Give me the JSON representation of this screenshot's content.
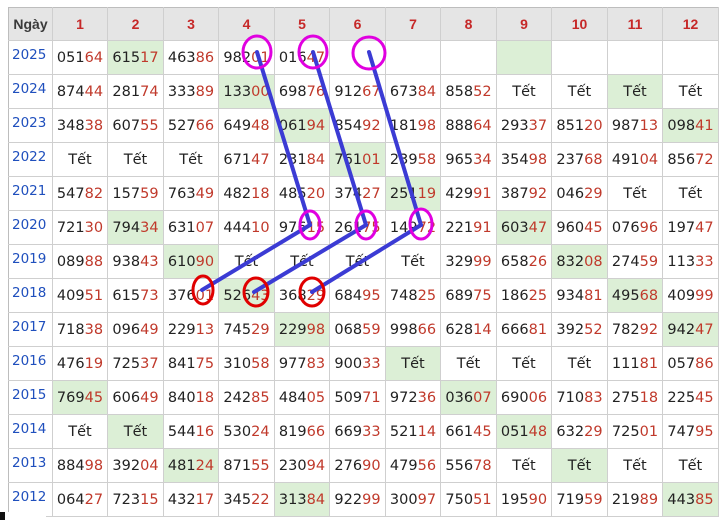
{
  "header": {
    "corner": "Ngày",
    "days": [
      "1",
      "2",
      "3",
      "4",
      "5",
      "6",
      "7",
      "8",
      "9",
      "10",
      "11",
      "12"
    ]
  },
  "rows": [
    {
      "year": "2025",
      "cells": [
        {
          "v": "05164"
        },
        {
          "v": "61517",
          "hl": true
        },
        {
          "v": "46386"
        },
        {
          "v": "98201"
        },
        {
          "v": "01647"
        },
        {
          "v": ""
        },
        {
          "v": ""
        },
        {
          "v": ""
        },
        {
          "v": "",
          "hl": true
        },
        {
          "v": ""
        },
        {
          "v": ""
        },
        {
          "v": ""
        }
      ]
    },
    {
      "year": "2024",
      "cells": [
        {
          "v": "87444"
        },
        {
          "v": "28174"
        },
        {
          "v": "33389"
        },
        {
          "v": "13300",
          "hl": true
        },
        {
          "v": "69876"
        },
        {
          "v": "91267"
        },
        {
          "v": "67384"
        },
        {
          "v": "85852"
        },
        {
          "v": "Tết"
        },
        {
          "v": "Tết"
        },
        {
          "v": "Tết",
          "hl": true
        },
        {
          "v": "Tết"
        }
      ]
    },
    {
      "year": "2023",
      "cells": [
        {
          "v": "34838"
        },
        {
          "v": "60755"
        },
        {
          "v": "52766"
        },
        {
          "v": "64948"
        },
        {
          "v": "06194",
          "hl": true
        },
        {
          "v": "85492"
        },
        {
          "v": "18198"
        },
        {
          "v": "88864"
        },
        {
          "v": "29337"
        },
        {
          "v": "85120"
        },
        {
          "v": "98713"
        },
        {
          "v": "09841",
          "hl": true
        }
      ]
    },
    {
      "year": "2022",
      "cells": [
        {
          "v": "Tết"
        },
        {
          "v": "Tết"
        },
        {
          "v": "Tết"
        },
        {
          "v": "67147"
        },
        {
          "v": "23184"
        },
        {
          "v": "76101",
          "hl": true
        },
        {
          "v": "23958"
        },
        {
          "v": "96534"
        },
        {
          "v": "35498"
        },
        {
          "v": "23768"
        },
        {
          "v": "49104"
        },
        {
          "v": "85672"
        }
      ]
    },
    {
      "year": "2021",
      "cells": [
        {
          "v": "54782"
        },
        {
          "v": "15759"
        },
        {
          "v": "76349"
        },
        {
          "v": "48218"
        },
        {
          "v": "48520"
        },
        {
          "v": "37427"
        },
        {
          "v": "25119",
          "hl": true
        },
        {
          "v": "42991"
        },
        {
          "v": "38792"
        },
        {
          "v": "04629"
        },
        {
          "v": "Tết"
        },
        {
          "v": "Tết"
        }
      ]
    },
    {
      "year": "2020",
      "cells": [
        {
          "v": "72130"
        },
        {
          "v": "79434",
          "hl": true
        },
        {
          "v": "63107"
        },
        {
          "v": "44410"
        },
        {
          "v": "97615"
        },
        {
          "v": "26175"
        },
        {
          "v": "14972"
        },
        {
          "v": "22191"
        },
        {
          "v": "60347",
          "hl": true
        },
        {
          "v": "96045"
        },
        {
          "v": "07696"
        },
        {
          "v": "19747"
        }
      ]
    },
    {
      "year": "2019",
      "cells": [
        {
          "v": "08988"
        },
        {
          "v": "93843"
        },
        {
          "v": "61090",
          "hl": true
        },
        {
          "v": "Tết"
        },
        {
          "v": "Tết"
        },
        {
          "v": "Tết"
        },
        {
          "v": "Tết"
        },
        {
          "v": "32999"
        },
        {
          "v": "65826"
        },
        {
          "v": "83208",
          "hl": true
        },
        {
          "v": "27459"
        },
        {
          "v": "11333"
        }
      ]
    },
    {
      "year": "2018",
      "cells": [
        {
          "v": "40951"
        },
        {
          "v": "61573"
        },
        {
          "v": "37601"
        },
        {
          "v": "52643",
          "hl": true
        },
        {
          "v": "36829"
        },
        {
          "v": "68495"
        },
        {
          "v": "74825"
        },
        {
          "v": "68975"
        },
        {
          "v": "18625"
        },
        {
          "v": "93481"
        },
        {
          "v": "49568",
          "hl": true
        },
        {
          "v": "40999"
        }
      ]
    },
    {
      "year": "2017",
      "cells": [
        {
          "v": "71838"
        },
        {
          "v": "09649"
        },
        {
          "v": "22913"
        },
        {
          "v": "74529"
        },
        {
          "v": "22998",
          "hl": true
        },
        {
          "v": "06859"
        },
        {
          "v": "99866"
        },
        {
          "v": "62814"
        },
        {
          "v": "66681"
        },
        {
          "v": "39252"
        },
        {
          "v": "78292"
        },
        {
          "v": "94247",
          "hl": true
        }
      ]
    },
    {
      "year": "2016",
      "cells": [
        {
          "v": "47619"
        },
        {
          "v": "72537"
        },
        {
          "v": "84175"
        },
        {
          "v": "31058"
        },
        {
          "v": "97783"
        },
        {
          "v": "90033"
        },
        {
          "v": "Tết",
          "hl": true
        },
        {
          "v": "Tết"
        },
        {
          "v": "Tết"
        },
        {
          "v": "Tết"
        },
        {
          "v": "11181"
        },
        {
          "v": "05786"
        }
      ]
    },
    {
      "year": "2015",
      "cells": [
        {
          "v": "76945",
          "hl": true
        },
        {
          "v": "60649"
        },
        {
          "v": "84018"
        },
        {
          "v": "24285"
        },
        {
          "v": "48405"
        },
        {
          "v": "50971"
        },
        {
          "v": "97236"
        },
        {
          "v": "03607",
          "hl": true
        },
        {
          "v": "69006"
        },
        {
          "v": "71083"
        },
        {
          "v": "27518"
        },
        {
          "v": "22545"
        }
      ]
    },
    {
      "year": "2014",
      "cells": [
        {
          "v": "Tết"
        },
        {
          "v": "Tết",
          "hl": true
        },
        {
          "v": "54416"
        },
        {
          "v": "53024"
        },
        {
          "v": "81966"
        },
        {
          "v": "66933"
        },
        {
          "v": "52114"
        },
        {
          "v": "66145"
        },
        {
          "v": "05148",
          "hl": true
        },
        {
          "v": "63229"
        },
        {
          "v": "72501"
        },
        {
          "v": "74795"
        }
      ]
    },
    {
      "year": "2013",
      "cells": [
        {
          "v": "88498"
        },
        {
          "v": "39204"
        },
        {
          "v": "48124",
          "hl": true
        },
        {
          "v": "87155"
        },
        {
          "v": "23094"
        },
        {
          "v": "27690"
        },
        {
          "v": "47956"
        },
        {
          "v": "55678"
        },
        {
          "v": "Tết"
        },
        {
          "v": "Tết",
          "hl": true
        },
        {
          "v": "Tết"
        },
        {
          "v": "Tết"
        }
      ]
    },
    {
      "year": "2012",
      "cells": [
        {
          "v": "06427"
        },
        {
          "v": "72315"
        },
        {
          "v": "43217"
        },
        {
          "v": "34522"
        },
        {
          "v": "31384",
          "hl": true
        },
        {
          "v": "92299"
        },
        {
          "v": "30097"
        },
        {
          "v": "75051"
        },
        {
          "v": "19590"
        },
        {
          "v": "71959"
        },
        {
          "v": "21989"
        },
        {
          "v": "44385",
          "hl": true
        }
      ]
    }
  ],
  "annotations": {
    "circle_color_top": "#e000e0",
    "circle_color_bottom": "#e00000",
    "line_color": "#3b3bd4"
  }
}
